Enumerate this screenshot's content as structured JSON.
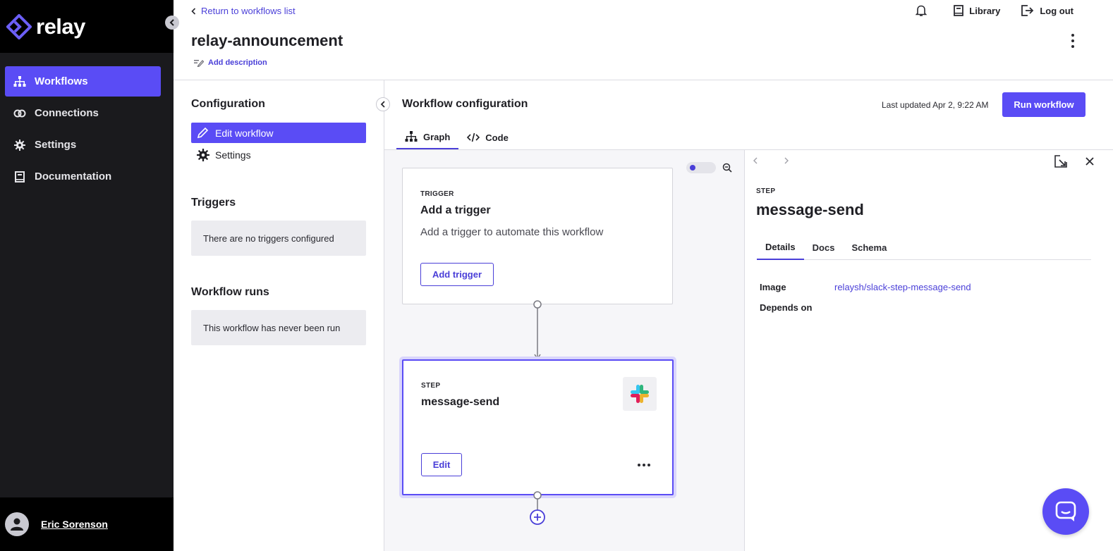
{
  "app": {
    "brand_name": "relay",
    "accent_color": "#5a4cf5"
  },
  "sidebar": {
    "items": [
      {
        "label": "Workflows",
        "icon": "sitemap-icon",
        "active": true
      },
      {
        "label": "Connections",
        "icon": "link-icon",
        "active": false
      },
      {
        "label": "Settings",
        "icon": "gear-icon",
        "active": false
      },
      {
        "label": "Documentation",
        "icon": "book-icon",
        "active": false
      }
    ],
    "user_name": "Eric Sorenson"
  },
  "header": {
    "back_link": "Return to workflows list",
    "title": "relay-announcement",
    "add_description": "Add description",
    "actions": {
      "library": "Library",
      "logout": "Log out"
    }
  },
  "configuration": {
    "title": "Configuration",
    "items": [
      {
        "label": "Edit workflow",
        "icon": "pencil-icon",
        "active": true
      },
      {
        "label": "Settings",
        "icon": "gear-icon",
        "active": false
      }
    ],
    "triggers_title": "Triggers",
    "triggers_empty": "There are no triggers configured",
    "runs_title": "Workflow runs",
    "runs_empty": "This workflow has never been run"
  },
  "workflow": {
    "title": "Workflow configuration",
    "last_updated": "Last updated Apr 2, 9:22 AM",
    "run_button": "Run workflow",
    "tabs": [
      {
        "label": "Graph",
        "icon": "sitemap-icon",
        "active": true
      },
      {
        "label": "Code",
        "icon": "code-icon",
        "active": false
      }
    ]
  },
  "graph": {
    "trigger_card": {
      "kicker": "TRIGGER",
      "title": "Add a trigger",
      "subtitle": "Add a trigger to automate this workflow",
      "button": "Add trigger"
    },
    "step_card": {
      "kicker": "STEP",
      "title": "message-send",
      "button": "Edit",
      "icon": "slack-icon"
    }
  },
  "detail": {
    "kicker": "STEP",
    "title": "message-send",
    "tabs": [
      {
        "label": "Details",
        "active": true
      },
      {
        "label": "Docs",
        "active": false
      },
      {
        "label": "Schema",
        "active": false
      }
    ],
    "fields": [
      {
        "label": "Image",
        "value": "relaysh/slack-step-message-send"
      },
      {
        "label": "Depends on",
        "value": ""
      }
    ]
  }
}
